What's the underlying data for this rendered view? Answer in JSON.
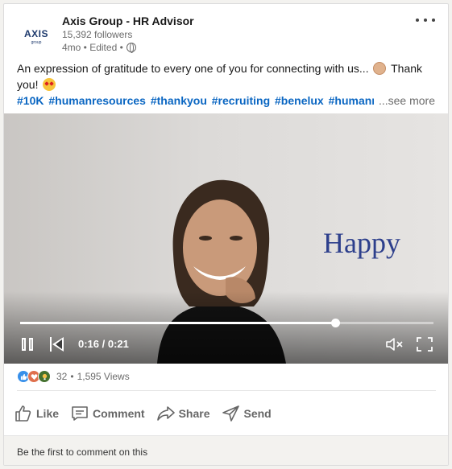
{
  "post": {
    "company": {
      "name": "Axis Group - HR Advisor",
      "logo_text": "AXIS",
      "logo_subtext": "group",
      "followers": "15,392 followers",
      "meta": "4mo • Edited •"
    },
    "text": {
      "body": "An expression of gratitude to every one of you for connecting with us...",
      "emoji_1": "clapping-hands-emoji",
      "body_2": "Thank you!",
      "emoji_2": "star-struck-emoji"
    },
    "hashtags": [
      "#10K",
      "#humanresources",
      "#thankyou",
      "#recruiting",
      "#benelux",
      "#humanresou"
    ],
    "see_more": "...see more"
  },
  "video": {
    "overlay_text": "Happy",
    "time_label": "0:16 / 0:21",
    "progress": 0.7619,
    "icons": {
      "pause": "pause-icon",
      "previous": "skip-back-icon",
      "mute": "muted-speaker-icon",
      "fullscreen": "fullscreen-icon"
    }
  },
  "social": {
    "reactions": [
      "like",
      "love",
      "insightful"
    ],
    "reaction_count": "32",
    "views": "1,595 Views"
  },
  "actions": [
    {
      "label": "Like",
      "icon": "thumbs-up-icon"
    },
    {
      "label": "Comment",
      "icon": "comment-icon"
    },
    {
      "label": "Share",
      "icon": "share-icon"
    },
    {
      "label": "Send",
      "icon": "send-icon"
    }
  ],
  "comment_prompt": "Be the first to comment on this",
  "colors": {
    "accent": "#0a66c2",
    "brand": "#1e3a6d",
    "overlay_text": "#2d3f8c"
  }
}
